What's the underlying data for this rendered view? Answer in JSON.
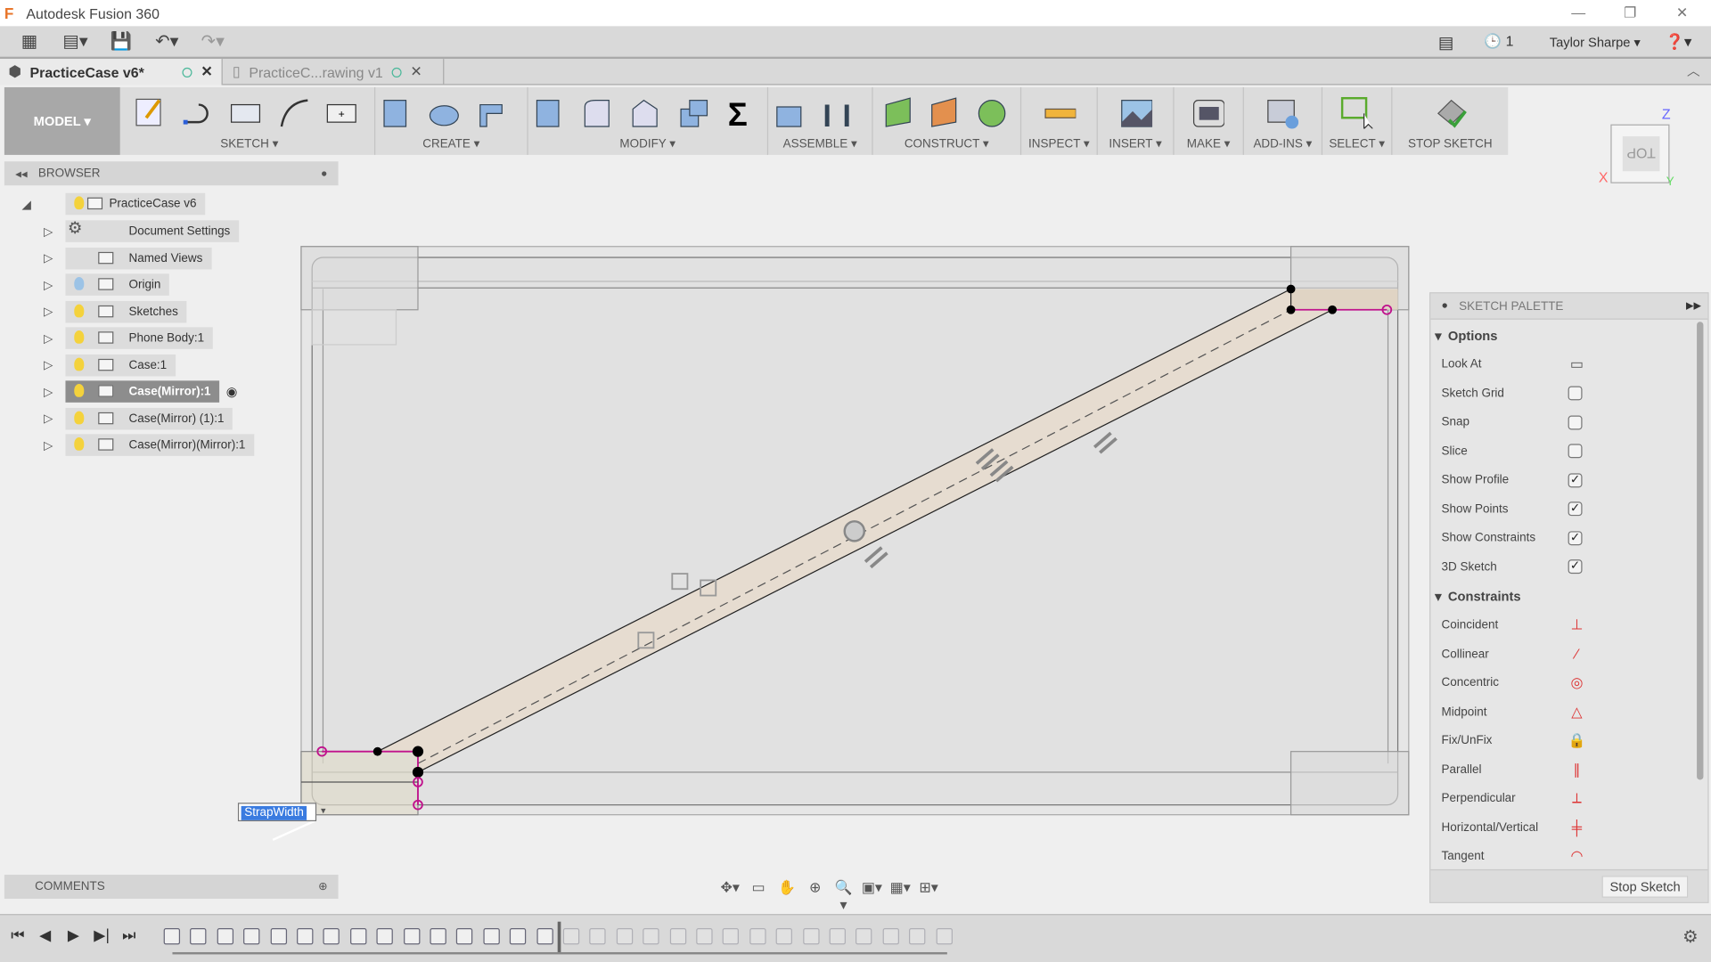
{
  "app": {
    "title": "Autodesk Fusion 360"
  },
  "quick_access": {
    "user": "Taylor Sharpe",
    "jobs_count": "1"
  },
  "tabs": [
    {
      "label": "PracticeCase v6*",
      "active": true
    },
    {
      "label": "PracticeC...rawing v1",
      "active": false
    }
  ],
  "toolbar": {
    "workspace": "MODEL ▾",
    "groups": [
      {
        "label": "SKETCH ▾"
      },
      {
        "label": "CREATE ▾"
      },
      {
        "label": "MODIFY ▾"
      },
      {
        "label": "ASSEMBLE ▾"
      },
      {
        "label": "CONSTRUCT ▾"
      },
      {
        "label": "INSPECT ▾"
      },
      {
        "label": "INSERT ▾"
      },
      {
        "label": "MAKE ▾"
      },
      {
        "label": "ADD-INS ▾"
      },
      {
        "label": "SELECT ▾"
      },
      {
        "label": "STOP SKETCH"
      }
    ]
  },
  "viewcube": {
    "face": "TOP",
    "x": "X",
    "y": "Y",
    "z": "Z"
  },
  "browser": {
    "title": "BROWSER",
    "root": "PracticeCase v6",
    "items": [
      {
        "label": "Document Settings",
        "icon": "gear-icon"
      },
      {
        "label": "Named Views",
        "icon": "folder-icon"
      },
      {
        "label": "Origin",
        "icon": "folder-icon"
      },
      {
        "label": "Sketches",
        "icon": "folder-icon"
      },
      {
        "label": "Phone Body:1",
        "icon": "component-icon"
      },
      {
        "label": "Case:1",
        "icon": "component-icon"
      },
      {
        "label": "Case(Mirror):1",
        "icon": "component-icon",
        "selected": true
      },
      {
        "label": "Case(Mirror) (1):1",
        "icon": "component-icon"
      },
      {
        "label": "Case(Mirror)(Mirror):1",
        "icon": "component-icon"
      }
    ]
  },
  "comments": {
    "title": "COMMENTS"
  },
  "dimension_input": {
    "value": "StrapWidth"
  },
  "palette": {
    "title": "SKETCH PALETTE",
    "options_label": "Options",
    "constraints_label": "Constraints",
    "options": [
      {
        "label": "Look At",
        "type": "button"
      },
      {
        "label": "Sketch Grid",
        "checked": false
      },
      {
        "label": "Snap",
        "checked": false
      },
      {
        "label": "Slice",
        "checked": false
      },
      {
        "label": "Show Profile",
        "checked": true
      },
      {
        "label": "Show Points",
        "checked": true
      },
      {
        "label": "Show Constraints",
        "checked": true
      },
      {
        "label": "3D Sketch",
        "checked": true
      }
    ],
    "constraints": [
      {
        "label": "Coincident",
        "glyph": "⊥"
      },
      {
        "label": "Collinear",
        "glyph": "⁄"
      },
      {
        "label": "Concentric",
        "glyph": "◎"
      },
      {
        "label": "Midpoint",
        "glyph": "△"
      },
      {
        "label": "Fix/UnFix",
        "glyph": "🔒"
      },
      {
        "label": "Parallel",
        "glyph": "∥"
      },
      {
        "label": "Perpendicular",
        "glyph": "⟂"
      },
      {
        "label": "Horizontal/Vertical",
        "glyph": "╪"
      },
      {
        "label": "Tangent",
        "glyph": "◠"
      }
    ],
    "stop_sketch": "Stop Sketch"
  },
  "colors": {
    "accent": "#3a7be0",
    "sketch_fill": "#e6dcd0",
    "constraint": "#c0128c",
    "selection": "#8d8d8d"
  }
}
